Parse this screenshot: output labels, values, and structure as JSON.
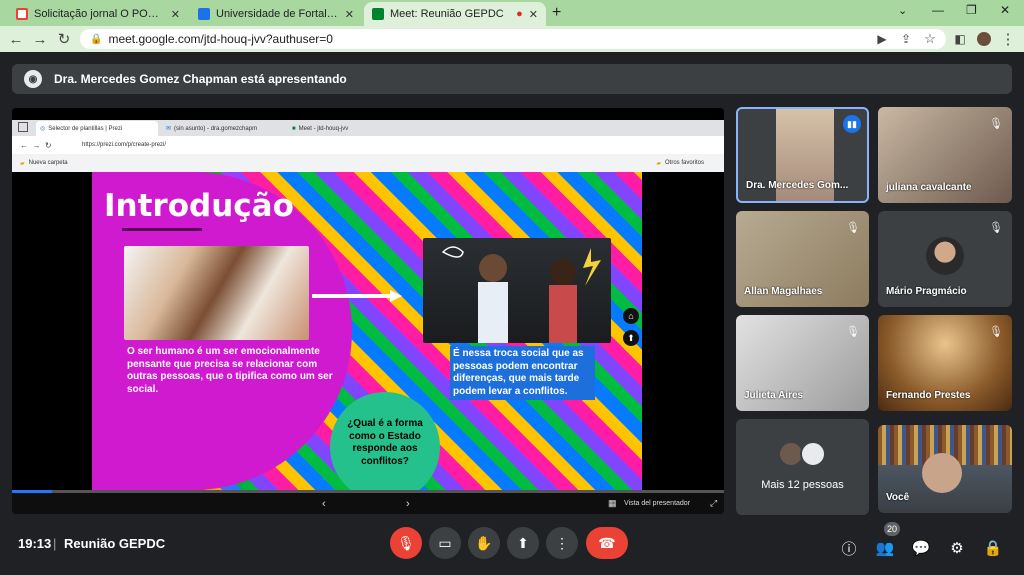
{
  "browser": {
    "tabs": [
      {
        "title": "Solicitação jornal O POVO - hum",
        "fav_color": "#ea4335",
        "fav_icon": "gmail-icon"
      },
      {
        "title": "Universidade de Fortaleza: agen",
        "fav_color": "#1a73e8",
        "fav_icon": "calendar-icon"
      },
      {
        "title": "Meet: Reunião GEPDC",
        "fav_color": "#00832d",
        "fav_icon": "meet-icon"
      }
    ],
    "url": "meet.google.com/jtd-houq-jvv?authuser=0",
    "new_tab": "+"
  },
  "presenting_banner": "Dra. Mercedes Gomez Chapman está apresentando",
  "presentation": {
    "inner_tabs": [
      "Selector de plantillas | Prezi",
      "(sin asunto) - dra.gomezchapm",
      "Meet - jtd-houq-jvv"
    ],
    "inner_url": "https://prezi.com/p/create-prezi/",
    "bookmark": "Nueva carpeta",
    "other_favorites": "Otros favoritos",
    "slide": {
      "title": "Introdução",
      "text_left": "O ser humano é um ser emocionalmente pensante que precisa se relacionar com outras pessoas, que o tipifica como um ser social.",
      "text_right": "É nessa troca social que as pessoas podem encontrar diferenças, que mais tarde podem levar a conflitos.",
      "question": "¿Qual é a forma como o Estado responde aos conflitos?"
    },
    "presenter_view": "Vista del presentador"
  },
  "participants": [
    {
      "name": "Dra. Mercedes Gom...",
      "speaking": true,
      "bg": "#8a7a6a"
    },
    {
      "name": "juliana cavalcante",
      "speaking": false,
      "bg": "#7a6e65"
    },
    {
      "name": "Allan Magalhaes",
      "speaking": false,
      "bg": "#9a8a6a"
    },
    {
      "name": "Mário Pragmácio",
      "speaking": false,
      "bg": "#3c4043"
    },
    {
      "name": "Julieta Aires",
      "speaking": false,
      "bg": "#8a8a8a"
    },
    {
      "name": "Fernando Prestes",
      "speaking": false,
      "bg": "#7a5a3a"
    },
    {
      "name": "Mais 12 pessoas",
      "speaking": false,
      "bg": "#3c4043"
    },
    {
      "name": "Você",
      "speaking": false,
      "bg": "#4a6a8a"
    }
  ],
  "footer": {
    "time": "19:13",
    "meeting_name": "Reunião GEPDC",
    "participant_count": "20"
  },
  "colors": {
    "end_call": "#ea4335",
    "mic_off": "#ea4335",
    "accent": "#8ab4f8"
  }
}
